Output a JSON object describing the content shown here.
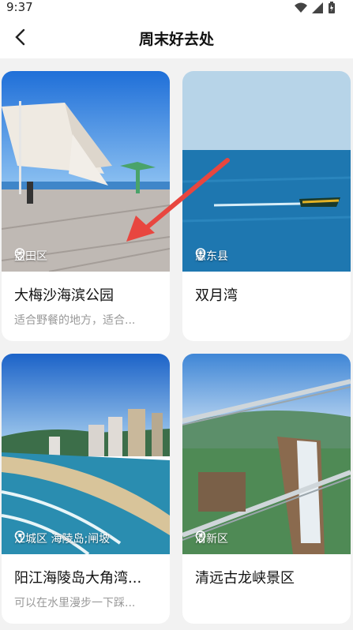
{
  "status": {
    "time": "9:37"
  },
  "header": {
    "title": "周末好去处",
    "back_icon": "back-arrow-icon"
  },
  "cards": [
    {
      "location": "盐田区",
      "name": "大梅沙海滨公园",
      "desc": "适合野餐的地方，适合..."
    },
    {
      "location": "惠东县",
      "name": "双月湾",
      "desc": ""
    },
    {
      "location": "江城区 海陵岛;闸坡",
      "name": "阳江海陵岛大角湾...",
      "desc": "可以在水里漫步一下踩..."
    },
    {
      "location": "清新区",
      "name": "清远古龙峡景区",
      "desc": ""
    }
  ],
  "colors": {
    "annotation_arrow": "#e8463f"
  }
}
